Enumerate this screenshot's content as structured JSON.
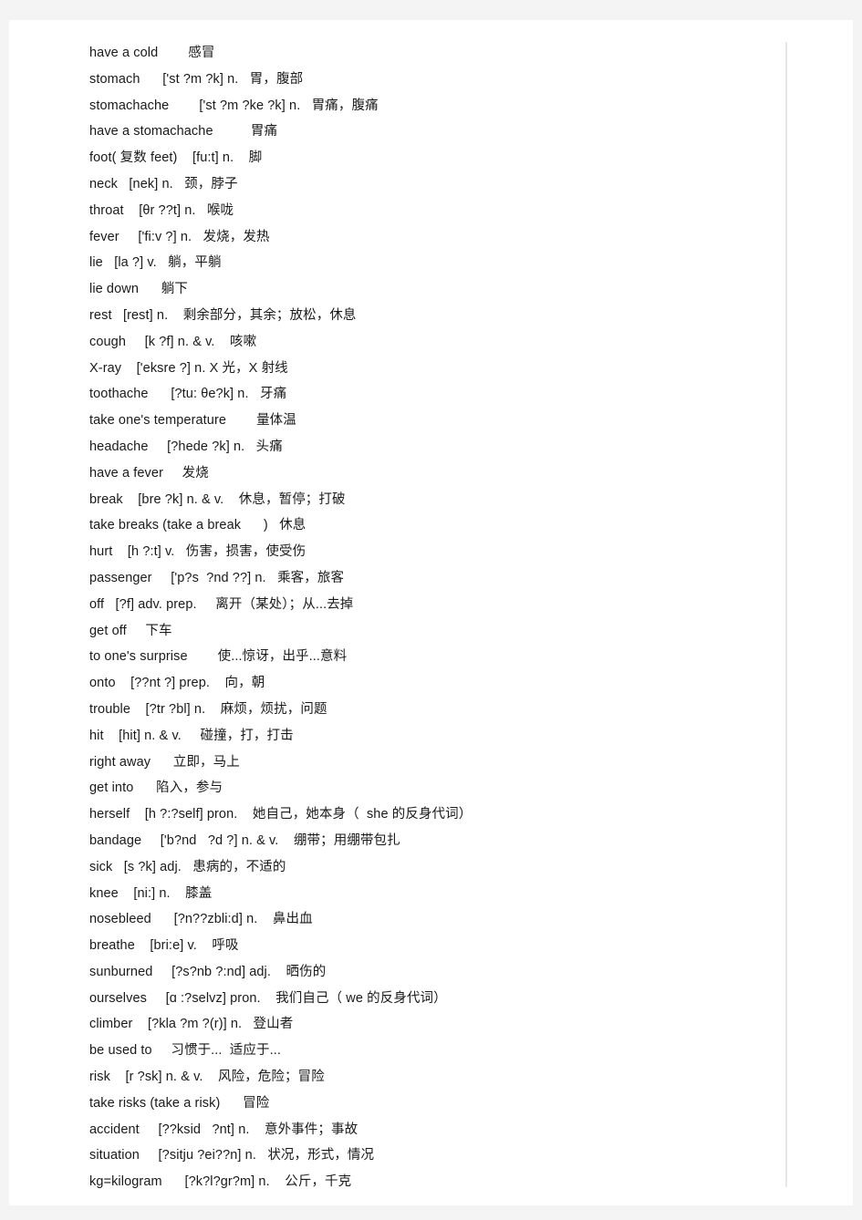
{
  "document": {
    "type": "vocabulary-list",
    "language_pair": "English-Chinese",
    "page_background": "#ffffff",
    "surround_background": "#f4f4f4",
    "rule_color": "#e6e6e6",
    "text_color": "#1a1a1a"
  },
  "entries": [
    {
      "line": "have a cold        感冒"
    },
    {
      "line": "stomach      ['st ?m ?k] n.   胃，腹部"
    },
    {
      "line": "stomachache        ['st ?m ?ke ?k] n.   胃痛，腹痛"
    },
    {
      "line": "have a stomachache          胃痛"
    },
    {
      "line": "foot( 复数 feet)    [fu:t] n.    脚"
    },
    {
      "line": "neck   [nek] n.   颈，脖子"
    },
    {
      "line": "throat    [θr ??t] n.   喉咙"
    },
    {
      "line": "fever     ['fi:v ?] n.   发烧，发热"
    },
    {
      "line": "lie   [la ?] v.   躺，平躺"
    },
    {
      "line": "lie down      躺下"
    },
    {
      "line": "rest   [rest] n.    剩余部分，其余；放松，休息"
    },
    {
      "line": "cough     [k ?f] n. & v.    咳嗽"
    },
    {
      "line": "X-ray    ['eksre ?] n. X 光，X 射线"
    },
    {
      "line": "toothache      [?tu: θe?k] n.   牙痛"
    },
    {
      "line": "take one's temperature        量体温"
    },
    {
      "line": "headache     [?hede ?k] n.   头痛"
    },
    {
      "line": "have a fever     发烧"
    },
    {
      "line": "break    [bre ?k] n. & v.    休息，暂停；打破"
    },
    {
      "line": "take breaks (take a break      )   休息"
    },
    {
      "line": "hurt    [h ?:t] v.   伤害，损害，使受伤"
    },
    {
      "line": "passenger     ['p?s  ?nd ??] n.   乘客，旅客"
    },
    {
      "line": "off   [?f] adv. prep.     离开（某处）；从...去掉"
    },
    {
      "line": "get off     下车"
    },
    {
      "line": "to one's surprise        使...惊讶，出乎...意料"
    },
    {
      "line": "onto    [??nt ?] prep.    向，朝"
    },
    {
      "line": "trouble    [?tr ?bl] n.    麻烦，烦扰，问题"
    },
    {
      "line": "hit    [hit] n. & v.     碰撞，打，打击"
    },
    {
      "line": "right away      立即，马上"
    },
    {
      "line": "get into      陷入，参与"
    },
    {
      "line": "herself    [h ?:?self] pron.    她自己，她本身（  she 的反身代词）"
    },
    {
      "line": "bandage     ['b?nd   ?d ?] n. & v.    绷带；用绷带包扎"
    },
    {
      "line": "sick   [s ?k] adj.   患病的，不适的"
    },
    {
      "line": "knee    [ni:] n.    膝盖"
    },
    {
      "line": "nosebleed      [?n??zbli:d] n.    鼻出血"
    },
    {
      "line": "breathe    [bri:e] v.    呼吸"
    },
    {
      "line": "sunburned     [?s?nb ?:nd] adj.    晒伤的"
    },
    {
      "line": "ourselves     [ɑ :?selvz] pron.    我们自己（ we 的反身代词）"
    },
    {
      "line": "climber    [?kla ?m ?(r)] n.   登山者"
    },
    {
      "line": "be used to     习惯于...  适应于..."
    },
    {
      "line": "risk    [r ?sk] n. & v.    风险，危险；冒险"
    },
    {
      "line": "take risks (take a risk)      冒险"
    },
    {
      "line": "accident     [??ksid   ?nt] n.    意外事件；事故"
    },
    {
      "line": "situation     [?sitju ?ei??n] n.   状况，形式，情况"
    },
    {
      "line": "kg=kilogram      [?k?l?gr?m] n.    公斤，千克"
    }
  ]
}
